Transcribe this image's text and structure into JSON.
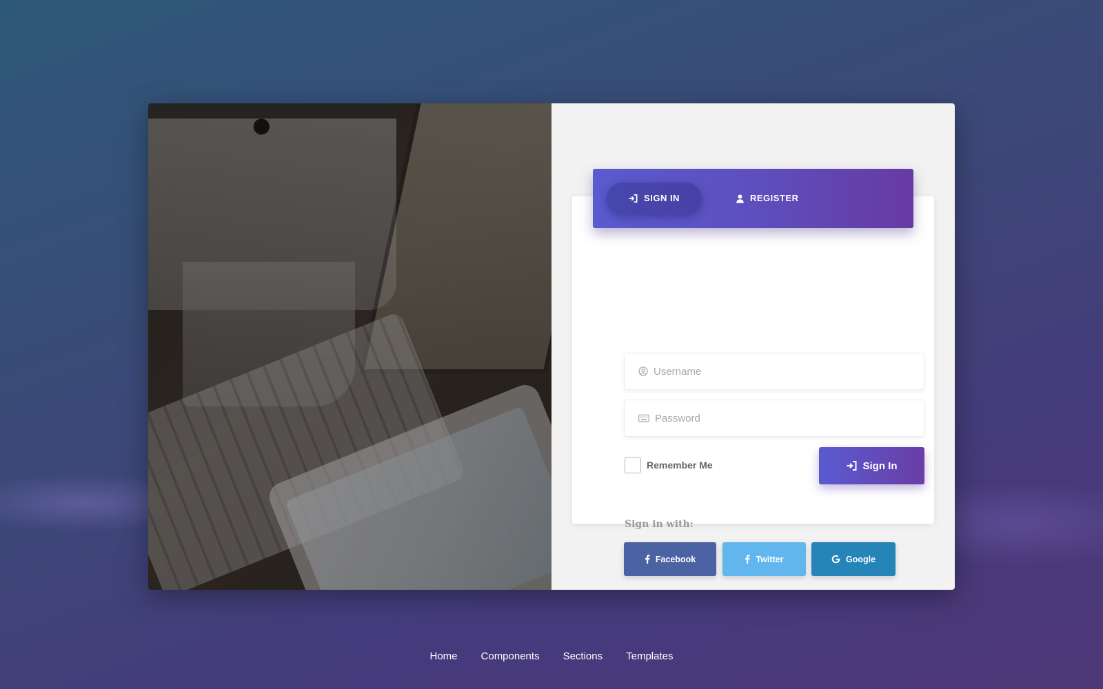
{
  "tabs": {
    "signin_label": "SIGN IN",
    "register_label": "REGISTER",
    "active": "SIGN IN"
  },
  "form": {
    "username_placeholder": "Username",
    "password_placeholder": "Password",
    "remember_label": "Remember Me",
    "remember_checked": false,
    "submit_label": "Sign In"
  },
  "social": {
    "heading": "Sign in with:",
    "facebook_label": "Facebook",
    "twitter_label": "Twitter",
    "google_label": "Google"
  },
  "footer": {
    "links": [
      "Home",
      "Components",
      "Sections",
      "Templates"
    ]
  },
  "colors": {
    "accent_start": "#5a5bd0",
    "accent_end": "#673aa2",
    "facebook": "#4b63a3",
    "twitter": "#62b6ee",
    "google": "#2584b8"
  },
  "icons": {
    "signin_tab": "sign-in-icon",
    "register_tab": "user-icon",
    "username": "user-circle-icon",
    "password": "keyboard-icon",
    "submit": "sign-in-icon",
    "facebook": "facebook-icon",
    "twitter": "twitter-icon",
    "google": "google-icon"
  }
}
